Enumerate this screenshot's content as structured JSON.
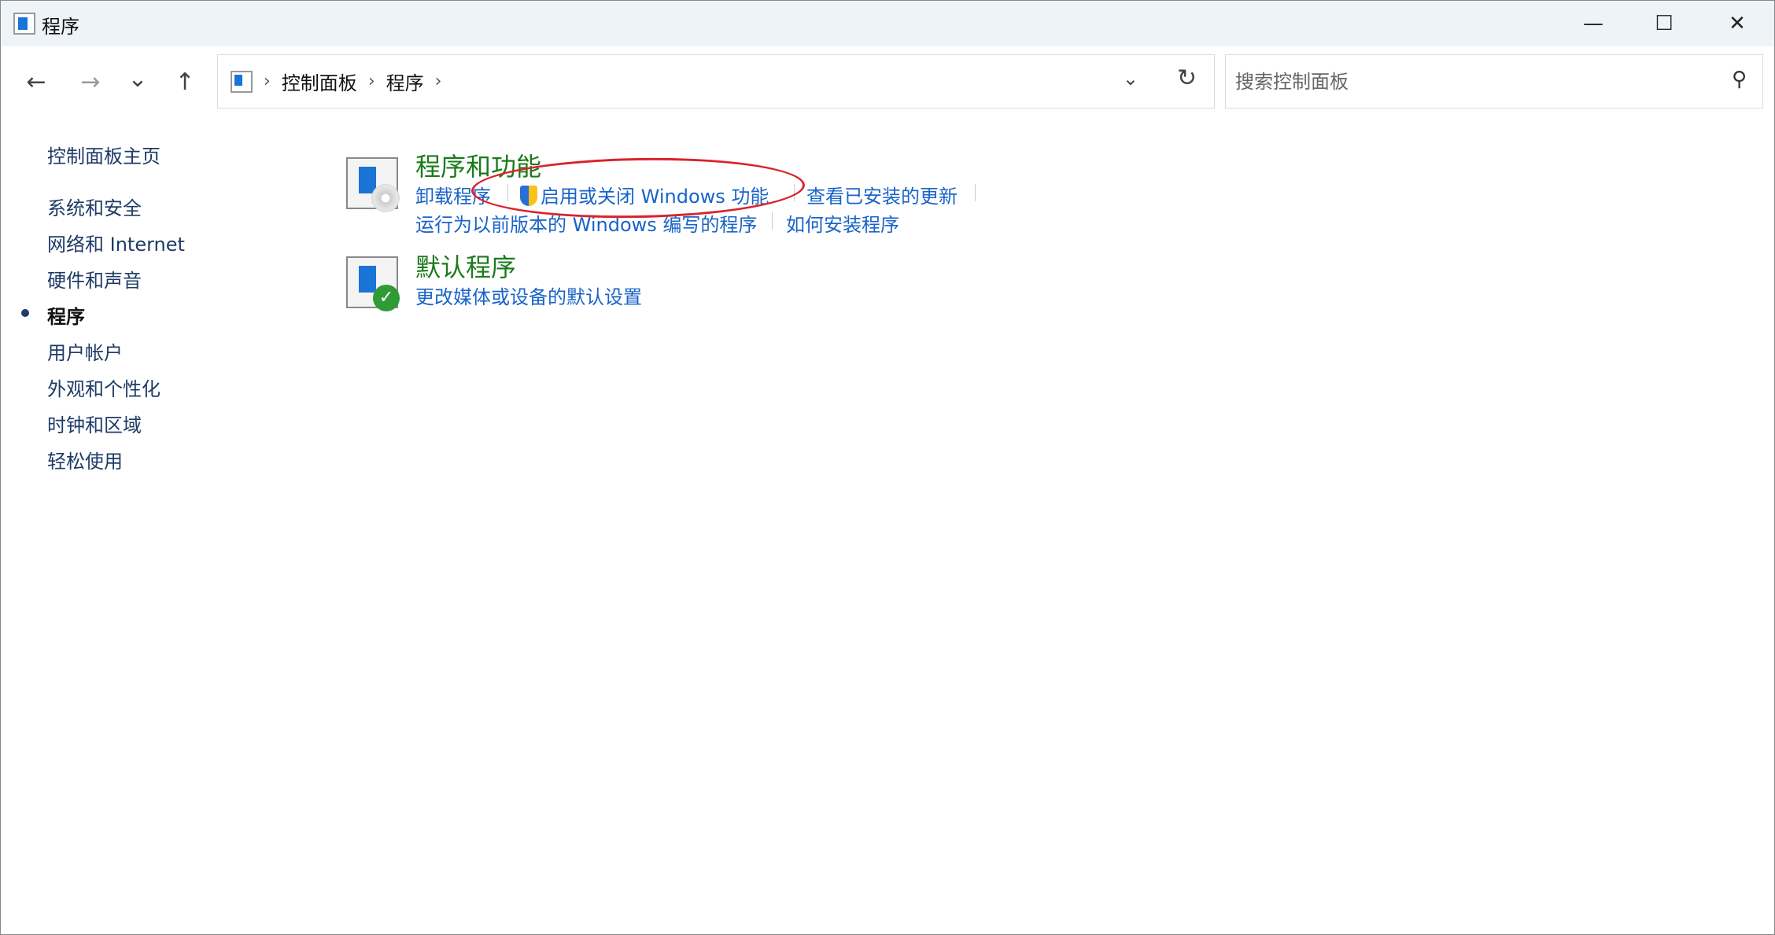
{
  "window": {
    "title": "程序",
    "minimize": "—",
    "maximize": "☐",
    "close": "✕"
  },
  "nav": {
    "back": "←",
    "forward": "→",
    "recent": "⌄",
    "up": "↑"
  },
  "address": {
    "crumbs": [
      "控制面板",
      "程序"
    ],
    "separator": "›",
    "dropdown": "⌄",
    "refresh": "↻"
  },
  "search": {
    "placeholder": "搜索控制面板",
    "icon": "⚲"
  },
  "sidebar": {
    "items": [
      "控制面板主页",
      "系统和安全",
      "网络和 Internet",
      "硬件和声音",
      "程序",
      "用户帐户",
      "外观和个性化",
      "时钟和区域",
      "轻松使用"
    ],
    "current": "程序"
  },
  "sections": [
    {
      "title": "程序和功能",
      "links": [
        "卸载程序",
        "启用或关闭 Windows 功能",
        "查看已安装的更新",
        "运行为以前版本的 Windows 编写的程序",
        "如何安装程序"
      ]
    },
    {
      "title": "默认程序",
      "links": [
        "更改媒体或设备的默认设置"
      ]
    }
  ],
  "colors": {
    "heading": "#1b7b1b",
    "link": "#1a64c8",
    "annotation": "#d9232d"
  }
}
